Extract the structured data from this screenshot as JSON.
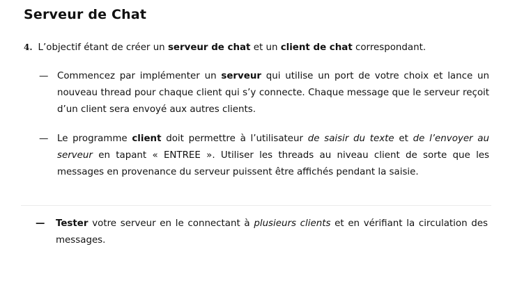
{
  "title": "Serveur de Chat",
  "intro": {
    "number": "4.",
    "t1": "L’objectif  étant de créer un ",
    "b1": "serveur de chat",
    "t2": " et un ",
    "b2": "client de chat",
    "t3": " correspondant."
  },
  "bullets": {
    "dash": "—",
    "item1": {
      "t1": "Commencez par implémenter un ",
      "b1": "serveur",
      "t2": " qui utilise un port de votre choix et lance un nouveau thread pour chaque client qui s’y connecte. Chaque message que le serveur reçoit d’un client sera envoyé aux autres clients."
    },
    "item2": {
      "t1": "Le programme ",
      "b1": "client",
      "t2": " doit permettre à l’utilisateur ",
      "i1": "de saisir du texte",
      "t3": " et ",
      "i2": "de l’envoyer au serveur",
      "t4": " en tapant « ENTREE ». Utiliser les threads au niveau client de sorte que les messages en provenance du serveur puissent être affichés pendant la saisie."
    },
    "item3": {
      "b1": "Tester",
      "t1": " votre serveur en le connectant à ",
      "i1": "plusieurs clients",
      "t2": " et en vérifiant la circulation des messages."
    }
  }
}
